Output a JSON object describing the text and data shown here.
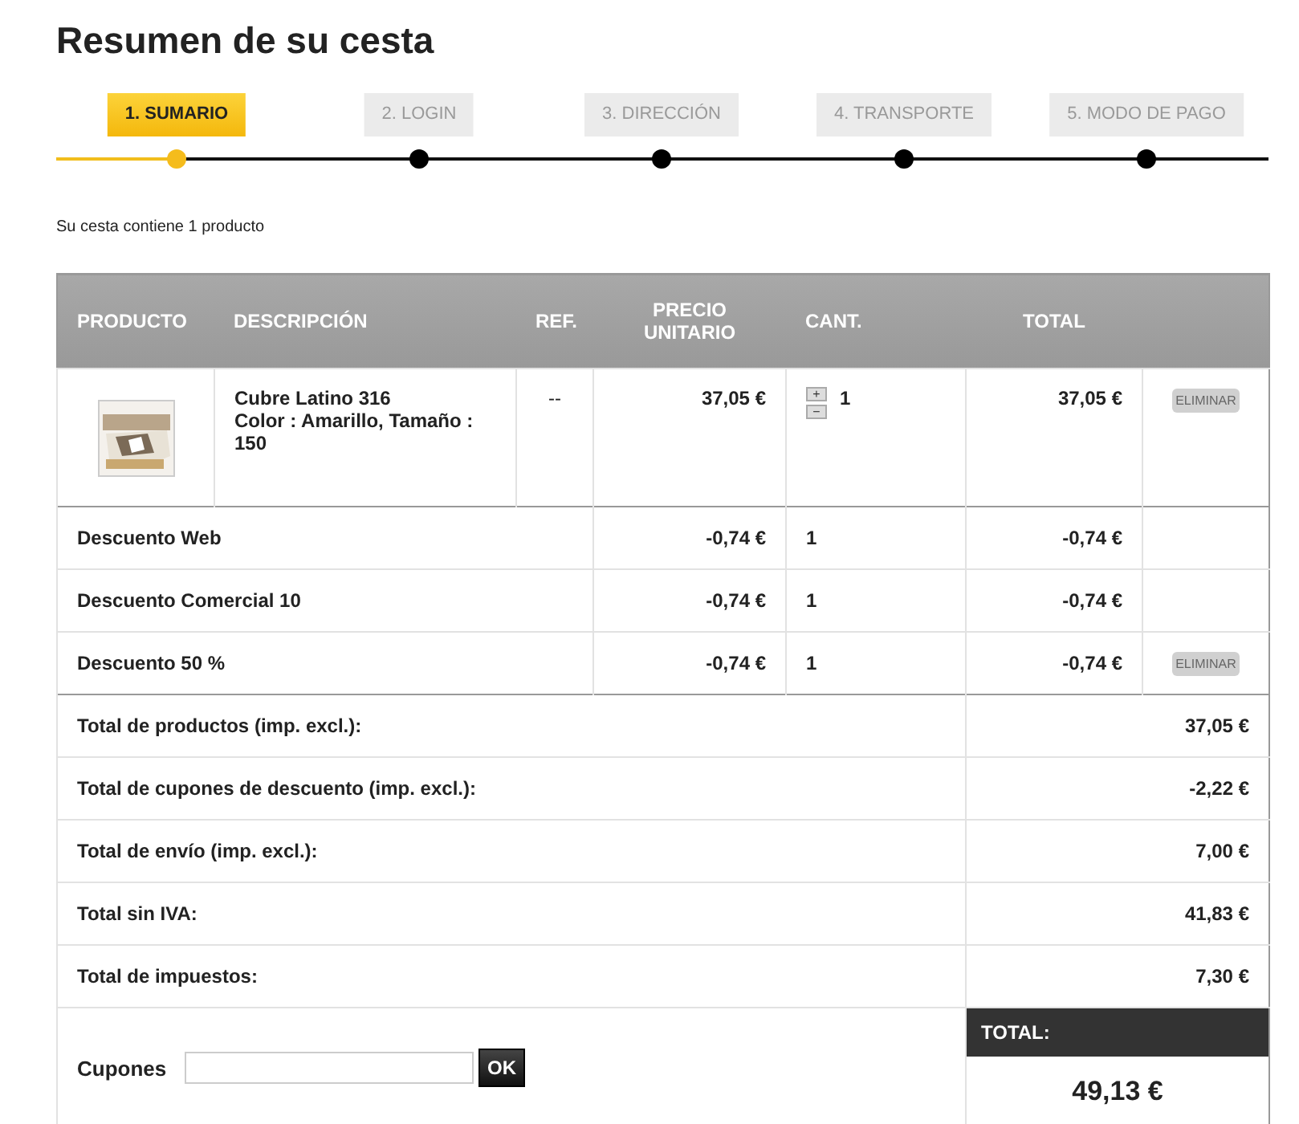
{
  "title": "Resumen de su cesta",
  "steps": [
    {
      "label": "1. SUMARIO",
      "selected": true
    },
    {
      "label": "2. LOGIN",
      "selected": false
    },
    {
      "label": "3. DIRECCIÓN",
      "selected": false
    },
    {
      "label": "4. TRANSPORTE",
      "selected": false
    },
    {
      "label": "5. MODO DE PAGO",
      "selected": false
    }
  ],
  "summary": "Su cesta contiene 1 producto",
  "columns": [
    "PRODUCTO",
    "DESCRIPCIÓN",
    "REF.",
    "PRECIO UNITARIO",
    "CANT.",
    "TOTAL"
  ],
  "product": {
    "kind": "picture",
    "name": "Cubre Latino 316",
    "attributes": "Color : Amarillo, Tamaño : 150",
    "ref": "--",
    "unit_price": "37,05 €",
    "qty_plus": "+",
    "qty_minus": "−",
    "quantity": "1",
    "total": "37,05 €",
    "remove": "ELIMINAR"
  },
  "discounts": [
    {
      "name": "Descuento Web",
      "unit_price": "-0,74 €",
      "quantity": "1",
      "total": "-0,74 €"
    },
    {
      "name": "Descuento Comercial 10",
      "unit_price": "-0,74 €",
      "quantity": "1",
      "total": "-0,74 €"
    },
    {
      "name": "Descuento 50 %",
      "unit_price": "-0,74 €",
      "quantity": "1",
      "total": "-0,74 €",
      "remove": "ELIMINAR"
    }
  ],
  "totals": [
    {
      "label": "Total de productos (imp. excl.):",
      "value": "37,05 €"
    },
    {
      "label": "Total de cupones de descuento (imp. excl.):",
      "value": "-2,22 €"
    },
    {
      "label": "Total de envío (imp. excl.):",
      "value": "7,00 €"
    },
    {
      "label": "Total sin IVA:",
      "value": "41,83 €"
    },
    {
      "label": "Total de impuestos:",
      "value": "7,30 €"
    }
  ],
  "coupon": {
    "label": "Cupones",
    "button": "OK"
  },
  "grand_total": {
    "label": "TOTAL:",
    "value": "49,13 €"
  }
}
